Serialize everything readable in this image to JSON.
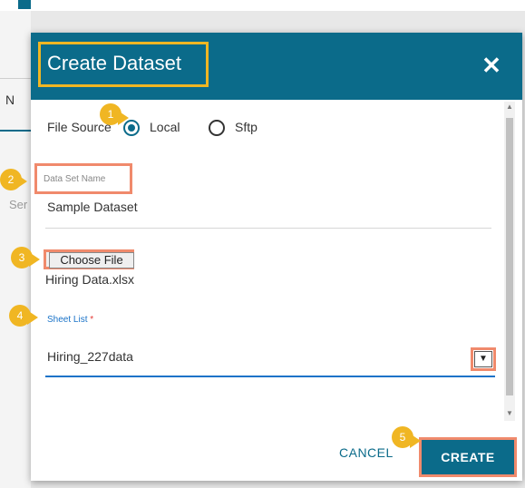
{
  "background": {
    "tab_label": "N",
    "field_hint": "Ser"
  },
  "dialog": {
    "title": "Create Dataset",
    "close_symbol": "✕"
  },
  "file_source": {
    "label": "File Source",
    "options": [
      "Local",
      "Sftp"
    ],
    "selected": "Local"
  },
  "dataset_name": {
    "label": "Data Set Name",
    "value": "Sample Dataset"
  },
  "file_picker": {
    "button_label": "Choose File",
    "file_name": "Hiring Data.xlsx"
  },
  "sheet_list": {
    "label": "Sheet List",
    "required_marker": "*",
    "value": "Hiring_227data",
    "dropdown_symbol": "▼"
  },
  "actions": {
    "cancel_label": "CANCEL",
    "create_label": "CREATE"
  },
  "steps": [
    "1",
    "2",
    "3",
    "4",
    "5"
  ],
  "colors": {
    "header": "#0b6b8a",
    "highlight_title": "#f0b623",
    "highlight_field": "#f08a6c",
    "step_badge": "#f0b623",
    "link_blue": "#1a73c8"
  }
}
